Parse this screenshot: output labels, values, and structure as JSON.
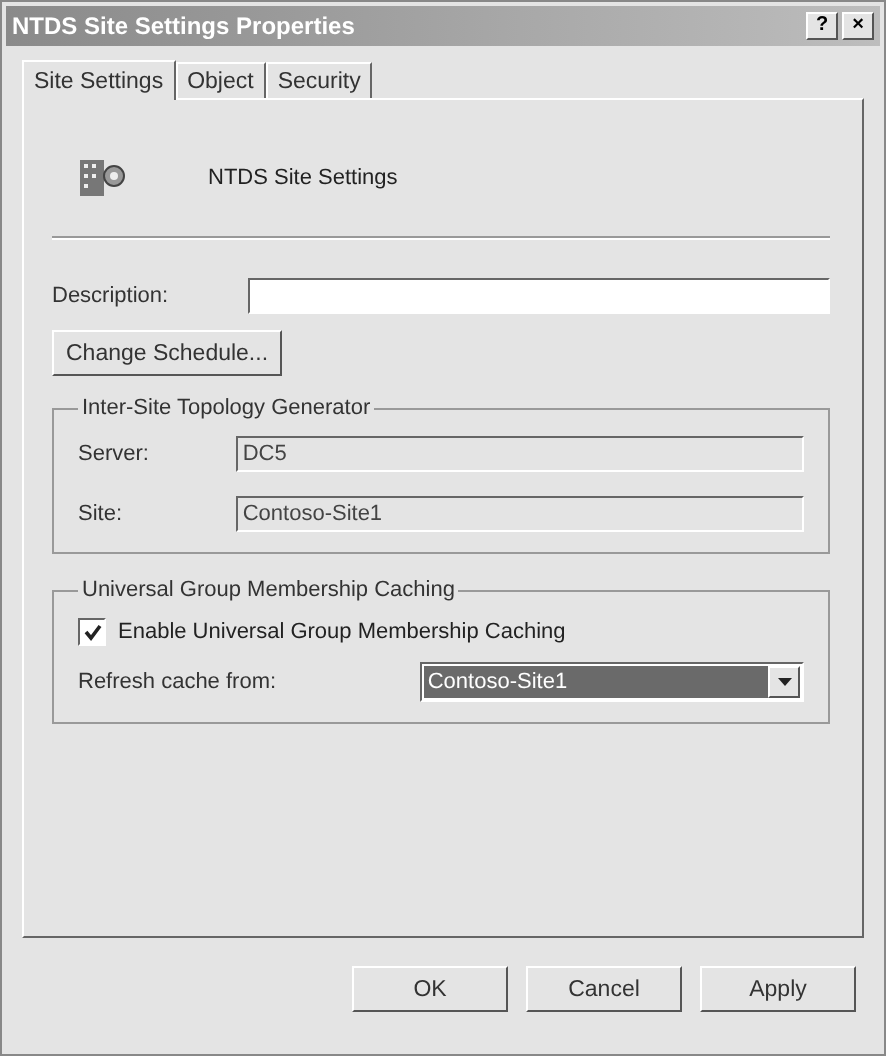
{
  "window": {
    "title": "NTDS Site Settings Properties",
    "title_buttons": [
      "?",
      "×"
    ]
  },
  "tabs": [
    {
      "label": "Site Settings",
      "selected": true
    },
    {
      "label": "Object",
      "selected": false
    },
    {
      "label": "Security",
      "selected": false
    }
  ],
  "header": {
    "title": "NTDS Site Settings"
  },
  "description": {
    "label": "Description:"
  },
  "change_schedule_button": "Change Schedule...",
  "topology_group": {
    "title": "Inter-Site Topology Generator",
    "fields": [
      {
        "label": "Server:",
        "value": "DC5"
      },
      {
        "label": "Site:",
        "value": "Contoso-Site1"
      }
    ]
  },
  "caching_group": {
    "title": "Universal Group Membership Caching",
    "checkbox": {
      "label": "Enable Universal Group Membership Caching",
      "checked": true
    },
    "refresh": {
      "label": "Refresh cache from:",
      "value": "Contoso-Site1"
    }
  },
  "buttons": [
    "OK",
    "Cancel",
    "Apply"
  ]
}
